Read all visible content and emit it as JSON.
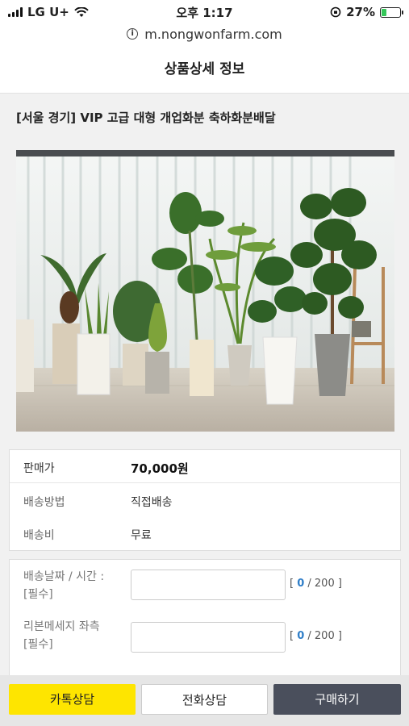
{
  "status_bar": {
    "carrier": "LG U+",
    "time": "오후 1:17",
    "battery": "27%",
    "battery_level": 0.27
  },
  "url_bar": {
    "url": "m.nongwonfarm.com",
    "icon": "info-icon"
  },
  "header": {
    "title": "상품상세 정보"
  },
  "product": {
    "title": "[서울 경기] VIP 고급 대형 개업화분 축하화분배달",
    "image_icon": "plant-photo"
  },
  "price_table": {
    "rows": [
      {
        "label": "판매가",
        "value": "70,000원"
      },
      {
        "label": "배송방법",
        "value": "직접배송"
      },
      {
        "label": "배송비",
        "value": "무료"
      }
    ]
  },
  "form": {
    "fields": [
      {
        "label_line1": "배송날짜 / 시간 :",
        "label_line2": "[필수]",
        "counter_open": "[ ",
        "counter_current": "0",
        "counter_rest": " / 200 ]"
      },
      {
        "label_line1": "리본메세지 좌측",
        "label_line2": "[필수]",
        "counter_open": "[ ",
        "counter_current": "0",
        "counter_rest": " / 200 ]"
      }
    ]
  },
  "bottom_bar": {
    "kakao_label": "카톡상담",
    "call_label": "전화상담",
    "buy_label": "구매하기"
  },
  "colors": {
    "kakao": "#fee500",
    "buy": "#4a4f5c",
    "counter_accent": "#2f7ec8"
  }
}
